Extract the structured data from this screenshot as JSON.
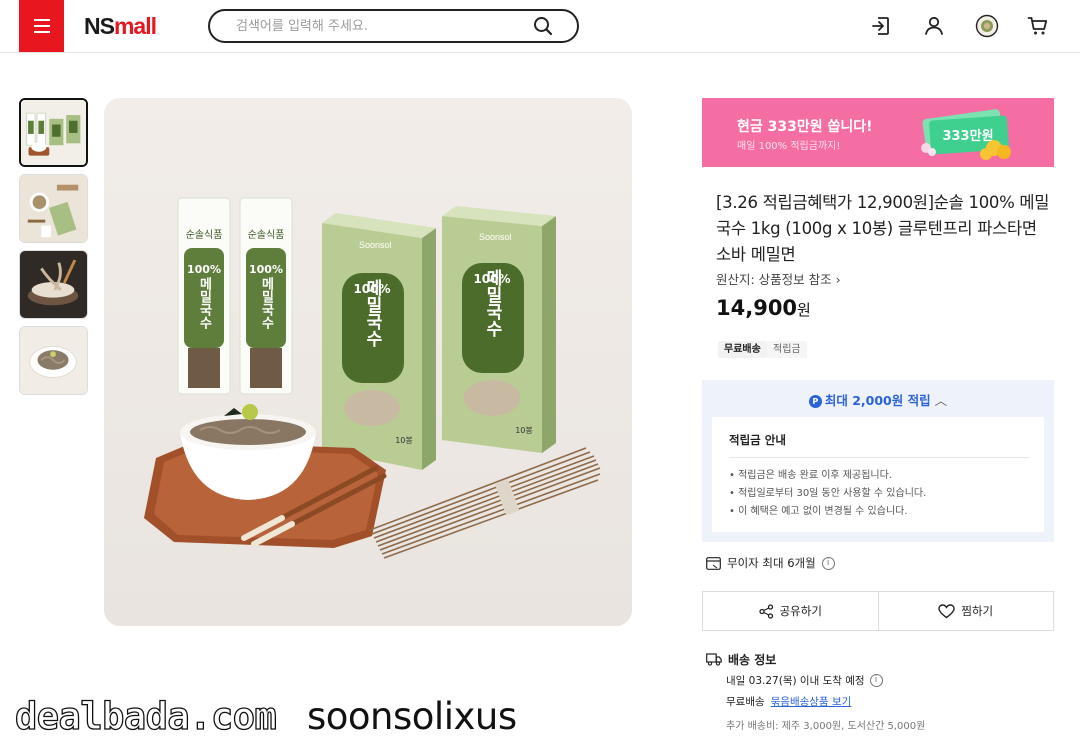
{
  "header": {
    "logo_ns": "NS",
    "logo_mall": "mall",
    "search_placeholder": "검색어를 입력해 주세요."
  },
  "colors": {
    "brand": "#e8161f",
    "banner": "#f56ea3",
    "point_blue": "#2b62d9"
  },
  "gallery": {
    "thumbnail_count": 4,
    "active_index": 0
  },
  "banner": {
    "title": "현금 333만원 쏩니다!",
    "subtitle": "매일 100% 적립금까지!",
    "art_text": "333만원"
  },
  "product": {
    "title": "[3.26 적립금혜택가 12,900원]순솔 100% 메밀국수 1kg (100g x 10봉) 글루텐프리 파스타면 소바 메밀면",
    "origin": "원산지: 상품정보 참조 ›",
    "price": "14,900",
    "price_unit": "원",
    "tags": [
      "무료배송",
      "적립금"
    ]
  },
  "reward": {
    "badge": "P",
    "prefix": "최대 ",
    "amount": "2,000원",
    "suffix": " 적립",
    "caret": "︿",
    "info_title": "적립금 안내",
    "notes": [
      "• 적립금은 배송 완료 이후 제공됩니다.",
      "• 적립일로부터 30일 동안 사용할 수 있습니다.",
      "• 이 혜택은 예고 없이 변경될 수 있습니다."
    ]
  },
  "installment": {
    "label": "무이자 최대 6개월",
    "info": "i"
  },
  "actions": {
    "share": "공유하기",
    "wish": "찜하기"
  },
  "shipping": {
    "title": "배송 정보",
    "eta": "내일 03.27(목) 이내 도착 예정",
    "fee_label": "무료배송",
    "bundle_link": "묶음배송상품 보기",
    "extra": "추가 배송비: 제주 3,000원, 도서산간 5,000원"
  },
  "packaging": {
    "brand": "순솔식품",
    "brand_en": "Soonsol",
    "percent": "100%",
    "name": "메밀국수",
    "count": "10봉"
  },
  "watermark": {
    "site": "dealbada.com",
    "user": "soonsolixus"
  }
}
